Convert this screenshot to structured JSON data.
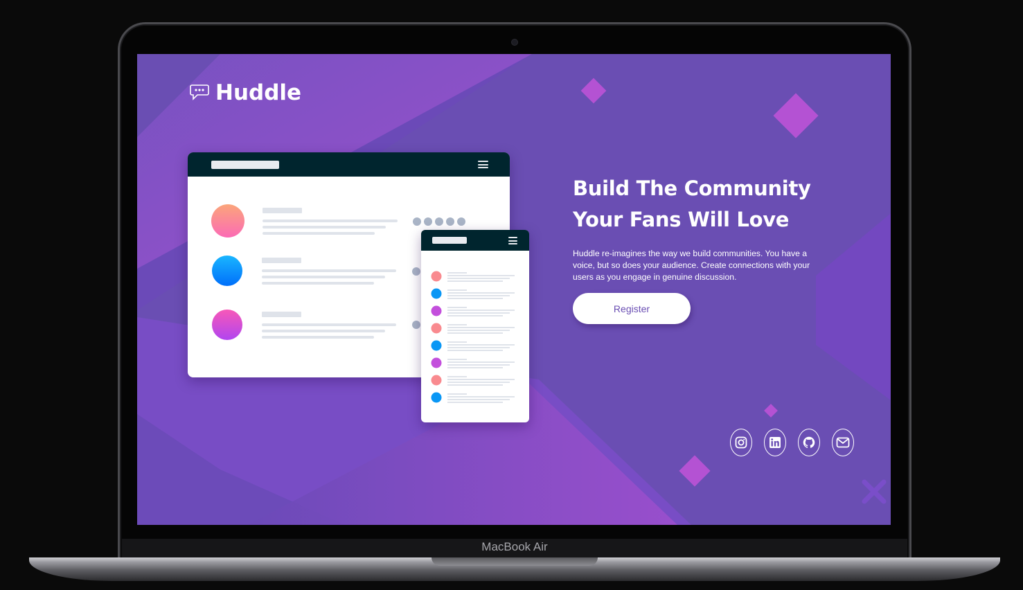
{
  "device": {
    "label": "MacBook Air"
  },
  "brand": {
    "name": "Huddle",
    "logo_icon": "chat-bubble-icon"
  },
  "hero": {
    "title_line1": "Build The Community",
    "title_line2": "Your Fans Will Love",
    "description": "Huddle re-imagines the way we build communities. You have a voice, but so does your audience. Create connections with your users as you engage in genuine discussion.",
    "cta_label": "Register"
  },
  "socials": [
    {
      "name": "instagram-icon"
    },
    {
      "name": "linkedin-icon"
    },
    {
      "name": "github-icon"
    },
    {
      "name": "mail-icon"
    }
  ],
  "colors": {
    "background": "#6a4eb3",
    "mock_header": "#00252e",
    "accent_pink": "#c65fe0",
    "cta_text": "#6a4eb3"
  }
}
